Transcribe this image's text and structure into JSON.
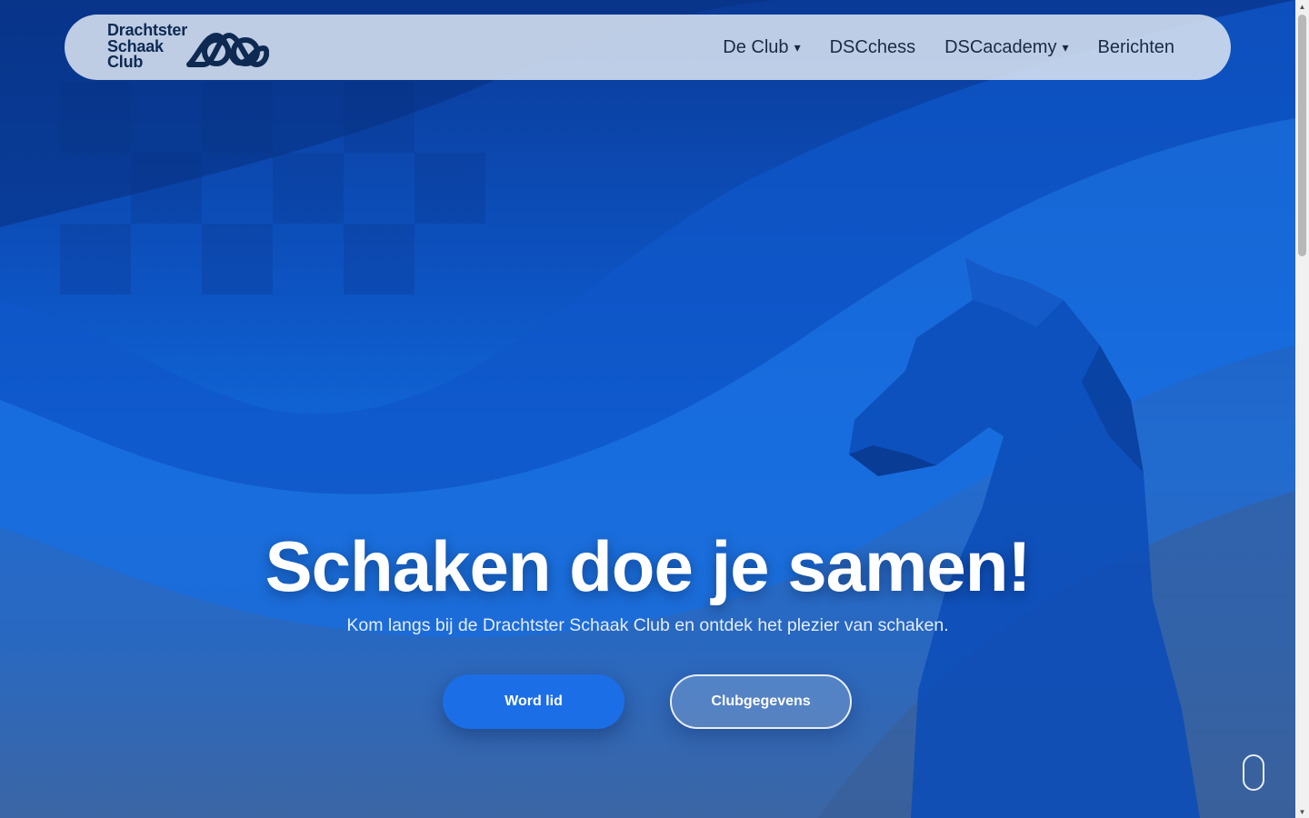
{
  "logo": {
    "lines": [
      "Drachtster",
      "Schaak",
      "Club"
    ],
    "mark_icon": "dsc-infinity-logo-icon"
  },
  "nav": {
    "items": [
      {
        "label": "De Club",
        "dropdown": true
      },
      {
        "label": "DSCchess",
        "dropdown": false
      },
      {
        "label": "DSCacademy",
        "dropdown": true
      },
      {
        "label": "Berichten",
        "dropdown": false
      }
    ],
    "caret": "▾"
  },
  "hero": {
    "headline": "Schaken doe je samen!",
    "subline": "Kom langs bij de Drachtster Schaak Club en ontdek het plezier van schaken.",
    "primary_button": "Word lid",
    "secondary_button": "Clubgegevens",
    "background_icon": "chess-knight-silhouette-icon",
    "scroll_icon": "mouse-scroll-icon"
  },
  "colors": {
    "accent": "#1c6ee6",
    "nav_bg": "#d7e1f0",
    "text_dark": "#0e2a52"
  }
}
